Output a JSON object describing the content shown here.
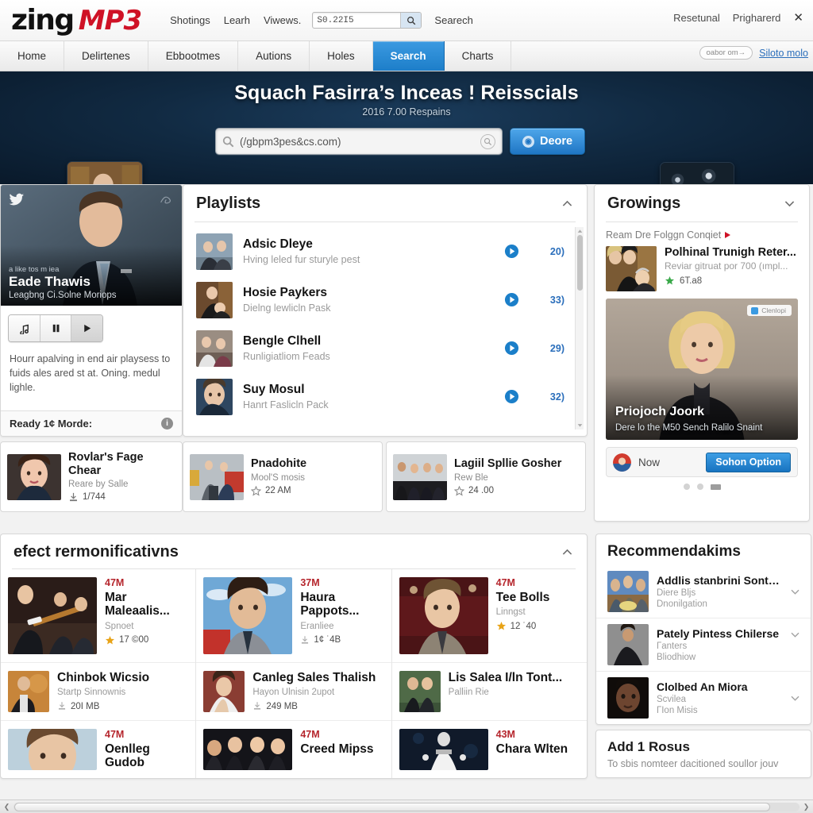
{
  "header": {
    "logo_primary": "zing",
    "logo_secondary": "MP3",
    "links": [
      "Shotings",
      "Learh",
      "Viwews.",
      "Searech"
    ],
    "search_value": "S0.22I5",
    "search_placeholder": "S0.22I5",
    "right_links": [
      "Resetunal",
      "Prigharerd"
    ],
    "close_label": "✕"
  },
  "nav": {
    "tabs": [
      {
        "label": "Home",
        "active": false
      },
      {
        "label": "Delirtenes",
        "active": false
      },
      {
        "label": "Ebbootmes",
        "active": false
      },
      {
        "label": "Autions",
        "active": false
      },
      {
        "label": "Holes",
        "active": false
      },
      {
        "label": "Search",
        "active": true
      },
      {
        "label": "Charts",
        "active": false
      }
    ],
    "pill": "oabor om→",
    "link": "Siloto molo"
  },
  "hero": {
    "title": "Squach Fasirra’s Inceas ! Reisscials",
    "subtitle": "2016 7.00 Respains",
    "search_value": "(/gbpm3pes&cs.com)",
    "search_placeholder": "(/gbpm3pes&cs.com)",
    "button_label": "Deore"
  },
  "artist": {
    "pre": "a like tos m iea",
    "name": "Eade Thawis",
    "role": "Leagbng Ci.Solne Moriops",
    "description": "Hourr apalving in end air playsess to fuids ales ared st at. Oning. medul lighle.",
    "footer_label": "Ready 1¢ Morde:"
  },
  "playlists": {
    "title": "Playlists",
    "items": [
      {
        "name": "Adsic Dleye",
        "sub": "Hving leled fur sturyle pest",
        "count": "20)"
      },
      {
        "name": "Hosie Paykers",
        "sub": "Dielng lewlicln Pask",
        "count": "33)"
      },
      {
        "name": "Bengle Clhell",
        "sub": "Runligiatliom Feads",
        "count": "29)"
      },
      {
        "name": "Suy Mosul",
        "sub": "Hanrt Faslicln Pack",
        "count": "32)"
      }
    ]
  },
  "tiles": [
    {
      "name": "Rovlar's Fage Chear",
      "sub": "Reare by Salle",
      "rating": "1/744"
    },
    {
      "name": "Pnadohite",
      "sub": "Mool'S mosis",
      "rating": "22 AM"
    },
    {
      "name": "Lagiil Spllie Gosher",
      "sub": "Rew Ble",
      "rating": "24 .00"
    }
  ],
  "growings": {
    "title": "Growings",
    "note": "Ream Dre Folggn Conqiet",
    "item": {
      "name": "Polhinal Trunigh Reter...",
      "sub": "Reviar gitruat por 700 (ımpl...",
      "rating": "6T.a8"
    },
    "feature": {
      "badge": "Clenlopi",
      "title": "Priojoch Joork",
      "subtitle": "Dere lo the M50 Sench Ralilo Snaint"
    },
    "nowbar": {
      "label": "Now",
      "button": "Sohon Option"
    }
  },
  "recommendations": {
    "title": "efect rermonificativns",
    "columns": [
      [
        {
          "dur": "47M",
          "name": "Mar Maleaalis...",
          "sub": "Spnoet",
          "rating": "17 ©00",
          "size": "large"
        },
        {
          "name": "Chinbok Wicsio",
          "sub": "Startp Sinnownis",
          "rating": "20I MB",
          "size": "small"
        },
        {
          "dur": "47M",
          "name": "Oenlleg Gudob",
          "sub": "",
          "rating": "",
          "size": "large"
        }
      ],
      [
        {
          "dur": "37M",
          "name": "Haura Pappots...",
          "sub": "Eranliee",
          "rating": "1¢ ˙4B",
          "size": "large"
        },
        {
          "name": "Canleg Sales Thalish",
          "sub": "Hayon Ulnisin 2upot",
          "rating": "249 MB",
          "size": "small"
        },
        {
          "dur": "47M",
          "name": "Creed Mipss",
          "sub": "",
          "rating": "",
          "size": "large"
        }
      ],
      [
        {
          "dur": "47M",
          "name": "Tee Bolls",
          "sub": "Linngst",
          "rating": "12 ˙40",
          "size": "large"
        },
        {
          "name": "Lis Salea I/ln Tont...",
          "sub": "Palliin Rie",
          "rating": "",
          "size": "small"
        },
        {
          "dur": "43M",
          "name": "Chara Wlten",
          "sub": "",
          "rating": "",
          "size": "large"
        }
      ]
    ]
  },
  "recommendakims": {
    "title": "Recommendakims",
    "items": [
      {
        "name": "Addlis stanbrini Sonther...",
        "s1": "Diеre Blјs",
        "s2": "Dnonilgation"
      },
      {
        "name": "Pately Pintess Chilerse",
        "s1": "Гanters",
        "s2": "Bliodhiow"
      },
      {
        "name": "Clolbed An Miora",
        "s1": "Scvilea",
        "s2": "ГIon Misis"
      }
    ]
  },
  "add_panel": {
    "title": "Add 1 Rosus",
    "subtitle": "To sbis nomteer dacitioned soullor jouv"
  },
  "colors": {
    "accent": "#1d7ec9",
    "brand_red": "#cf1226",
    "link": "#2a6ebb",
    "duration": "#b5252c"
  }
}
